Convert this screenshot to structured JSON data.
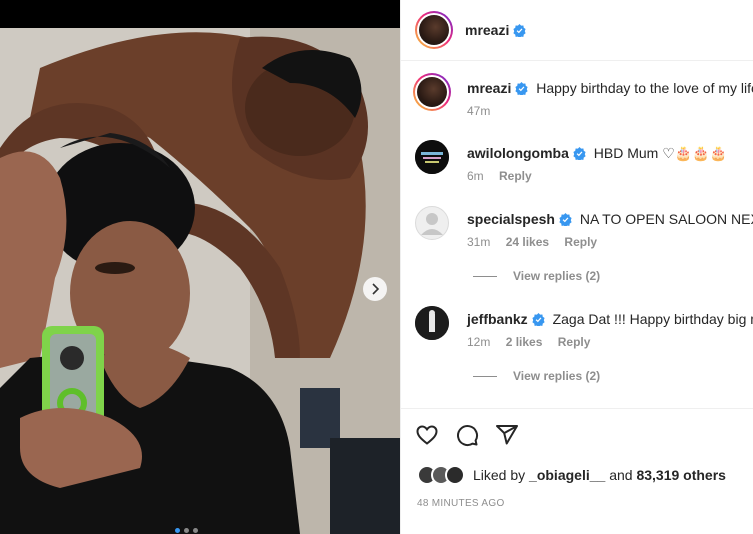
{
  "post": {
    "image_alt": "",
    "carousel_dots": 3,
    "active_dot": 0
  },
  "header": {
    "username": "mreazi",
    "verified": true
  },
  "caption": {
    "username": "mreazi",
    "text": "Happy birthday to the love of my life",
    "time": "47m"
  },
  "comments": [
    {
      "username": "awilolongomba",
      "text": "HBD Mum ♡🎂🎂🎂",
      "time": "6m",
      "likes": "",
      "reply": "Reply",
      "view_replies": ""
    },
    {
      "username": "specialspesh",
      "text": "NA TO OPEN SALOON NEXT OOO",
      "time": "31m",
      "likes": "24 likes",
      "reply": "Reply",
      "view_replies": "View replies (2)"
    },
    {
      "username": "jeffbankz",
      "text": "Zaga Dat !!! Happy birthday big mama",
      "time": "12m",
      "likes": "2 likes",
      "reply": "Reply",
      "view_replies": "View replies (2)"
    }
  ],
  "likes": {
    "prefix": "Liked by",
    "user": "_obiageli__",
    "joiner": "and",
    "count": "83,319 others"
  },
  "timestamp": "48 MINUTES AGO",
  "colors": {
    "verified": "#3897f0",
    "muted": "#8e8e8e",
    "text": "#262626"
  },
  "icons": [
    "heart-icon",
    "comment-icon",
    "share-icon",
    "chevron-right-icon",
    "verified-badge-icon"
  ]
}
